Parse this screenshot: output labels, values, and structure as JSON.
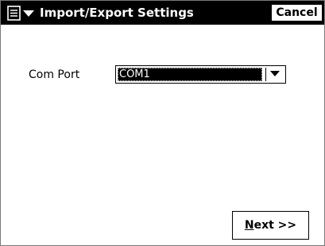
{
  "titlebar": {
    "menu_icon": "start-menu-icon",
    "title": "Import/Export Settings",
    "cancel_label": "Cancel"
  },
  "form": {
    "com_port": {
      "label": "Com Port",
      "value": "COM1",
      "dropdown_icon": "chevron-down-icon"
    }
  },
  "footer": {
    "next_mnemonic": "N",
    "next_rest": "ext >>"
  },
  "colors": {
    "titlebar_bg": "#000000",
    "titlebar_text": "#ffffff",
    "selection_bg": "#000000",
    "selection_text": "#ffffff"
  }
}
